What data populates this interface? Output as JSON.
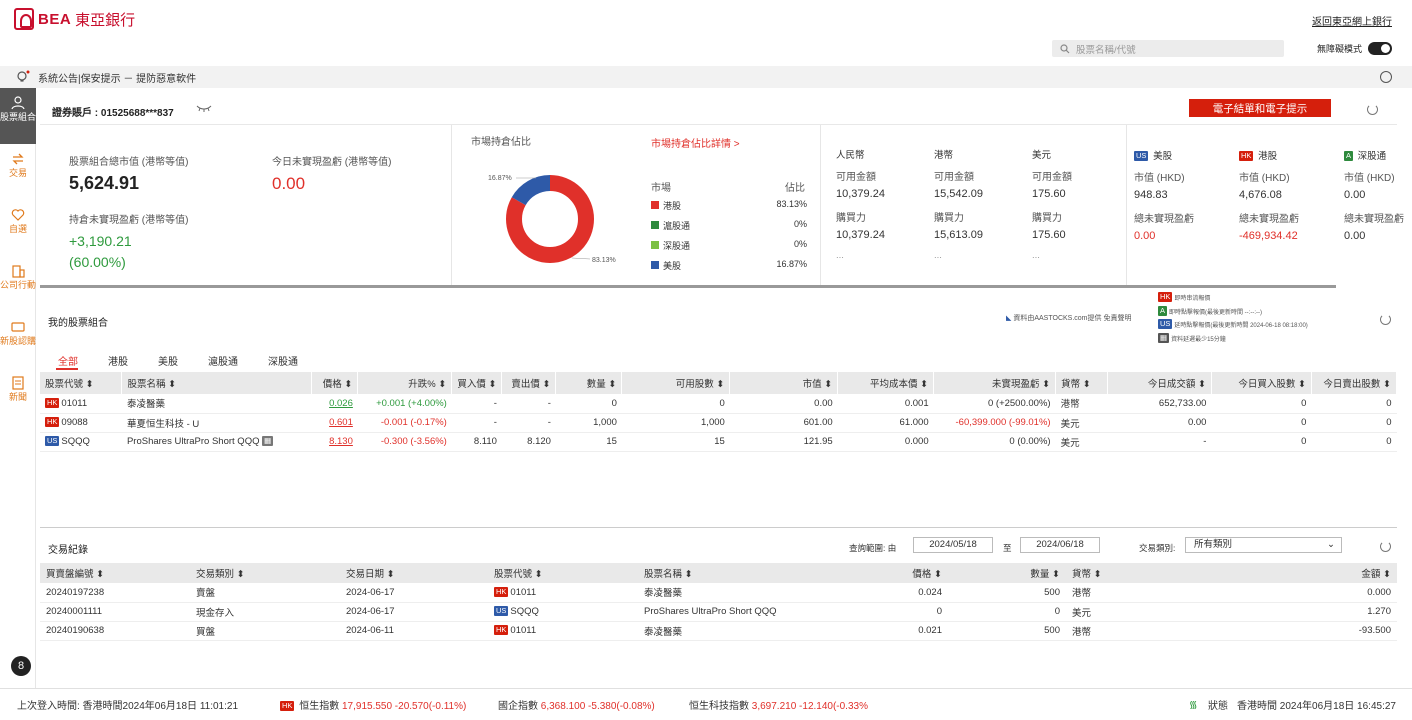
{
  "header": {
    "brand_en": "BEA",
    "brand_zh": "東亞銀行",
    "back_link": "返回東亞網上銀行",
    "search_placeholder": "股票名稱/代號",
    "no_block_mode": "無障礙模式"
  },
  "notice": {
    "text": "系統公告|保安提示 － 提防惡意軟件"
  },
  "sidebar": {
    "items": [
      {
        "label": "股票組合",
        "icon": "briefcase-icon",
        "active": true
      },
      {
        "label": "交易",
        "icon": "exchange-icon"
      },
      {
        "label": "自選",
        "icon": "heart-icon"
      },
      {
        "label": "公司行動",
        "icon": "building-icon"
      },
      {
        "label": "新股認購",
        "icon": "ipo-icon"
      },
      {
        "label": "新聞",
        "icon": "news-icon"
      }
    ]
  },
  "account": {
    "label": "證券賬戶 : 01525688***837",
    "ebutton": "電子結單和電子提示"
  },
  "summary": {
    "total_label": "股票組合總市值 (港幣等值)",
    "total_value": "5,624.91",
    "today_label": "今日未實現盈虧 (港幣等值)",
    "today_value": "0.00",
    "hold_label": "持倉未實現盈虧 (港幣等值)",
    "hold_value": "+3,190.21",
    "hold_pct": "(60.00%)"
  },
  "allocation": {
    "title": "市場持倉佔比",
    "detail_link": "市場持倉佔比詳情 >",
    "col_market": "市場",
    "col_pct": "佔比",
    "label_small": "16.87%",
    "label_large": "83.13%",
    "rows": [
      {
        "name": "港股",
        "pct": "83.13%",
        "color": "#e0302a"
      },
      {
        "name": "滬股通",
        "pct": "0%",
        "color": "#2e8a3d"
      },
      {
        "name": "深股通",
        "pct": "0%",
        "color": "#7bc043"
      },
      {
        "name": "美股",
        "pct": "16.87%",
        "color": "#2e5aa8"
      }
    ],
    "slices": [
      {
        "name": "港股",
        "value": 83.13,
        "color": "#e0302a"
      },
      {
        "name": "美股",
        "value": 16.87,
        "color": "#2e5aa8"
      }
    ]
  },
  "cash": {
    "cols": [
      {
        "currency": "人民幣",
        "avail_label": "可用金額",
        "avail": "10,379.24",
        "power_label": "購買力",
        "power": "10,379.24",
        "more": "..."
      },
      {
        "currency": "港幣",
        "avail_label": "可用金額",
        "avail": "15,542.09",
        "power_label": "購買力",
        "power": "15,613.09",
        "more": "..."
      },
      {
        "currency": "美元",
        "avail_label": "可用金額",
        "avail": "175.60",
        "power_label": "購買力",
        "power": "175.60",
        "more": "..."
      }
    ]
  },
  "markets": {
    "cols": [
      {
        "badge": "US",
        "name": "美股",
        "mv_label": "市值 (HKD)",
        "mv": "948.83",
        "pl_label": "總未實現盈虧",
        "pl": "0.00"
      },
      {
        "badge": "HK",
        "name": "港股",
        "mv_label": "市值 (HKD)",
        "mv": "4,676.08",
        "pl_label": "總未實現盈虧",
        "pl": "-469,934.42"
      },
      {
        "badge": "A",
        "name": "深股通",
        "mv_label": "市值 (HKD)",
        "mv": "0.00",
        "pl_label": "總未實現盈虧",
        "pl": "0.00"
      }
    ]
  },
  "portfolio": {
    "title": "我的股票組合",
    "source": "資料由AASTOCKS.com提供 免責聲明",
    "legend": [
      "即時串流報價",
      "即時點擊報價(最後更新時間 --:--:--)",
      "延時點擊報價(最後更新時間 2024-06-18 08:18:00)",
      "資料延遲最少15分鐘"
    ],
    "tabs": [
      "全部",
      "港股",
      "美股",
      "滬股通",
      "深股通"
    ],
    "headers": [
      "股票代號 ⬍",
      "股票名稱 ⬍",
      "價格 ⬍",
      "升跌% ⬍",
      "買入價 ⬍",
      "賣出價 ⬍",
      "數量 ⬍",
      "可用股數 ⬍",
      "市值 ⬍",
      "平均成本價 ⬍",
      "未實現盈虧 ⬍",
      "貨幣 ⬍",
      "今日成交額 ⬍",
      "今日買入股數 ⬍",
      "今日賣出股數 ⬍"
    ],
    "rows": [
      {
        "mkt": "HK",
        "code": "01011",
        "name": "泰凌醫藥",
        "price": "0.026",
        "chg": "+0.001 (+4.00%)",
        "bid": "-",
        "ask": "-",
        "qty": "0",
        "avail": "0",
        "mv": "0.00",
        "cost": "0.001",
        "pl": "0 (+2500.00%)",
        "cur": "港幣",
        "turnover": "652,733.00",
        "buy": "0",
        "sell": "0",
        "price_color": "#2e9a3d",
        "chg_color": "#2e9a3d",
        "pl_color": "#333"
      },
      {
        "mkt": "HK",
        "code": "09088",
        "name": "華夏恒生科技 - U",
        "price": "0.601",
        "chg": "-0.001 (-0.17%)",
        "bid": "-",
        "ask": "-",
        "qty": "1,000",
        "avail": "1,000",
        "mv": "601.00",
        "cost": "61.000",
        "pl": "-60,399.000 (-99.01%)",
        "cur": "美元",
        "turnover": "0.00",
        "buy": "0",
        "sell": "0",
        "price_color": "#e0302a",
        "chg_color": "#e0302a",
        "pl_color": "#e0302a"
      },
      {
        "mkt": "US",
        "code": "SQQQ",
        "name": "ProShares UltraPro Short QQQ",
        "price": "8.130",
        "chg": "-0.300 (-3.56%)",
        "bid": "8.110",
        "ask": "8.120",
        "qty": "15",
        "avail": "15",
        "mv": "121.95",
        "cost": "0.000",
        "pl": "0 (0.00%)",
        "cur": "美元",
        "turnover": "-",
        "buy": "0",
        "sell": "0",
        "price_color": "#e0302a",
        "chg_color": "#e0302a",
        "pl_color": "#333"
      }
    ]
  },
  "trades": {
    "title": "交易紀錄",
    "range_label": "查詢範圍: 由",
    "from": "2024/05/18",
    "to_label": "至",
    "to": "2024/06/18",
    "type_label": "交易類別:",
    "type_value": "所有類別",
    "headers": [
      "買賣盤編號 ⬍",
      "交易類別 ⬍",
      "交易日期 ⬍",
      "股票代號 ⬍",
      "股票名稱 ⬍",
      "價格 ⬍",
      "數量 ⬍",
      "貨幣 ⬍",
      "金額 ⬍"
    ],
    "rows": [
      {
        "id": "20240197238",
        "type": "賣盤",
        "date": "2024-06-17",
        "mkt": "HK",
        "code": "01011",
        "name": "泰凌醫藥",
        "price": "0.024",
        "qty": "500",
        "cur": "港幣",
        "amount": "0.000"
      },
      {
        "id": "20240001111",
        "type": "現金存入",
        "date": "2024-06-17",
        "mkt": "US",
        "code": "SQQQ",
        "name": "ProShares UltraPro Short QQQ",
        "price": "0",
        "qty": "0",
        "cur": "美元",
        "amount": "1.270"
      },
      {
        "id": "20240190638",
        "type": "買盤",
        "date": "2024-06-11",
        "mkt": "HK",
        "code": "01011",
        "name": "泰凌醫藥",
        "price": "0.021",
        "qty": "500",
        "cur": "港幣",
        "amount": "-93.500"
      }
    ]
  },
  "footer": {
    "last_login": "上次登入時間: 香港時間2024年06月18日 11:01:21",
    "indices": [
      {
        "name": "恒生指數",
        "value": "17,915.550 -20.570(-0.11%)"
      },
      {
        "name": "國企指數",
        "value": "6,368.100 -5.380(-0.08%)"
      },
      {
        "name": "恒生科技指數",
        "value": "3,697.210 -12.140(-0.33%"
      }
    ],
    "status": "狀態",
    "time": "香港時間 2024年06月18日 16:45:27"
  },
  "colors": {
    "brand": "#c8102e",
    "up": "#2e9a3d",
    "down": "#e0302a",
    "accent": "#d51f0c"
  }
}
